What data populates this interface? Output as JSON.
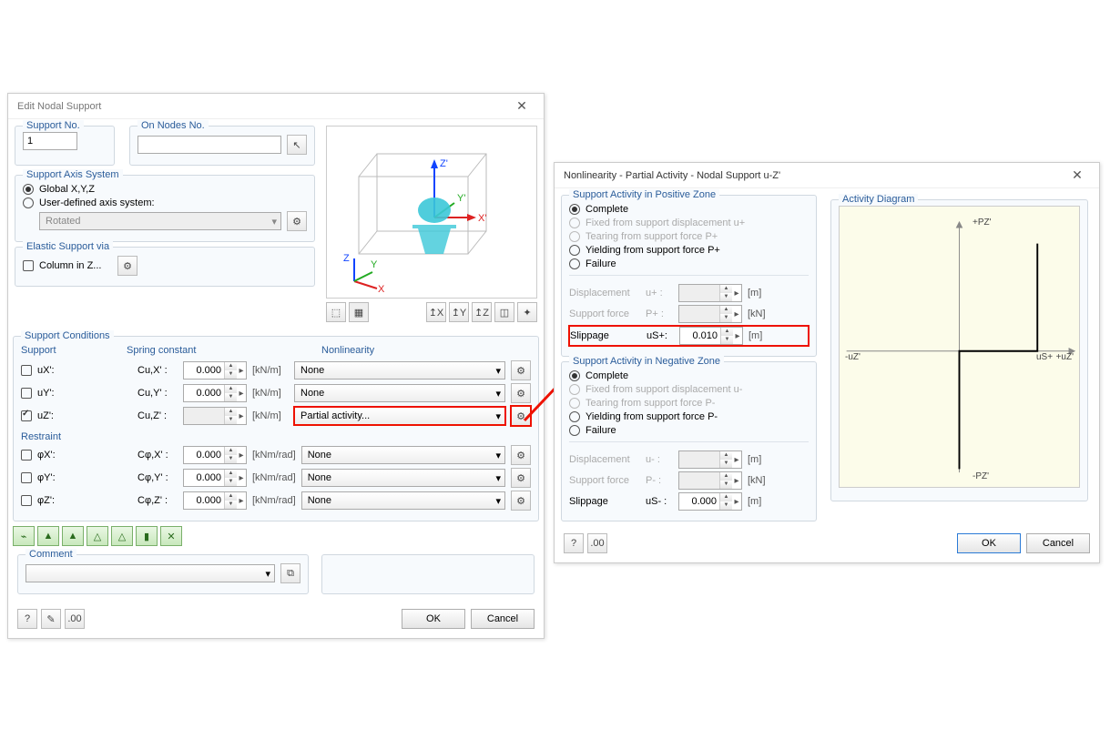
{
  "dialog1": {
    "title": "Edit Nodal Support",
    "group_supportno": "Support No.",
    "group_onnodes": "On Nodes No.",
    "supportno_value": "1",
    "group_axis": "Support Axis System",
    "radio_global": "Global X,Y,Z",
    "radio_userdef": "User-defined axis system:",
    "userdef_value": "Rotated",
    "group_elastic": "Elastic Support via",
    "chk_column": "Column in Z...",
    "group_conditions": "Support Conditions",
    "hdr_support": "Support",
    "hdr_spring": "Spring constant",
    "hdr_nonlin": "Nonlinearity",
    "sup_ux": "uX':",
    "sup_uy": "uY':",
    "sup_uz": "uZ':",
    "c_ux": "Cu,X' :",
    "c_uy": "Cu,Y' :",
    "c_uz": "Cu,Z' :",
    "val000": "0.000",
    "u_knm": "[kN/m]",
    "u_knmrad": "[kNm/rad]",
    "nl_none": "None",
    "nl_partial": "Partial activity...",
    "hdr_restraint": "Restraint",
    "re_px": "φX':",
    "re_py": "φY':",
    "re_pz": "φZ':",
    "cphi_x": "Cφ,X' :",
    "cphi_y": "Cφ,Y' :",
    "cphi_z": "Cφ,Z' :",
    "group_comment": "Comment",
    "ok": "OK",
    "cancel": "Cancel"
  },
  "dialog2": {
    "title": "Nonlinearity - Partial Activity - Nodal Support u-Z'",
    "group_pos": "Support Activity in Positive Zone",
    "r_complete": "Complete",
    "r_fixed_p": "Fixed from support displacement u+",
    "r_tear_p": "Tearing from support force P+",
    "r_yield_p": "Yielding from support force P+",
    "r_failure": "Failure",
    "lbl_disp": "Displacement",
    "lbl_force": "Support force",
    "lbl_slip": "Slippage",
    "sym_u_p": "u+ :",
    "sym_P_p": "P+ :",
    "sym_us_p": "uS+:",
    "sym_u_n": "u- :",
    "sym_P_n": "P- :",
    "sym_us_n": "uS- :",
    "val_slip_p": "0.010",
    "val_slip_n": "0.000",
    "u_m": "[m]",
    "u_kn": "[kN]",
    "group_neg": "Support Activity in Negative Zone",
    "r_fixed_n": "Fixed from support displacement u-",
    "r_tear_n": "Tearing from support force P-",
    "r_yield_n": "Yielding from support force P-",
    "group_diag": "Activity Diagram",
    "diag_pz_top": "+PZ'",
    "diag_pz_bot": "-PZ'",
    "diag_uz_l": "-uZ'",
    "diag_uz_r": "+uZ'",
    "diag_us": "uS+",
    "ok": "OK",
    "cancel": "Cancel"
  }
}
